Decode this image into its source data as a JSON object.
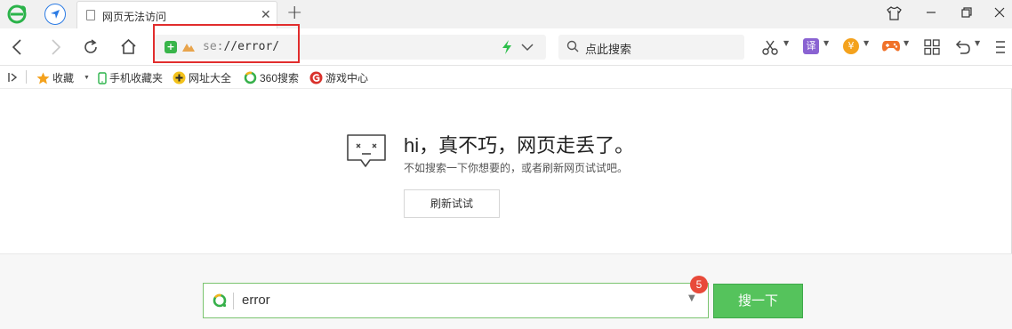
{
  "tabbar": {
    "tab_title": "网页无法访问",
    "close_glyph": "✕",
    "new_tab_glyph": "+",
    "window_controls": [
      "shirt-icon",
      "minimize",
      "restore",
      "close"
    ]
  },
  "toolbar": {
    "url_scheme": "se:",
    "url_path": "//error/",
    "search_placeholder": "点此搜索",
    "translate_label": "译",
    "yen_label": "¥"
  },
  "bookmarks": {
    "items": [
      {
        "label": "收藏",
        "icon": "star-icon"
      },
      {
        "label": "手机收藏夹",
        "icon": "phone-icon"
      },
      {
        "label": "网址大全",
        "icon": "plus-circle-icon"
      },
      {
        "label": "360搜索",
        "icon": "360-search-icon"
      },
      {
        "label": "游戏中心",
        "icon": "game-center-icon"
      }
    ]
  },
  "error_page": {
    "title": "hi，真不巧，网页走丢了。",
    "subtitle": "不如搜索一下你想要的，或者刷新网页试试吧。",
    "refresh_button": "刷新试试"
  },
  "footer_search": {
    "value": "error",
    "badge": "5",
    "button": "搜一下"
  },
  "colors": {
    "accent_green": "#55c35c",
    "highlight_red": "#e12d2d",
    "shield_green": "#39b54a"
  }
}
